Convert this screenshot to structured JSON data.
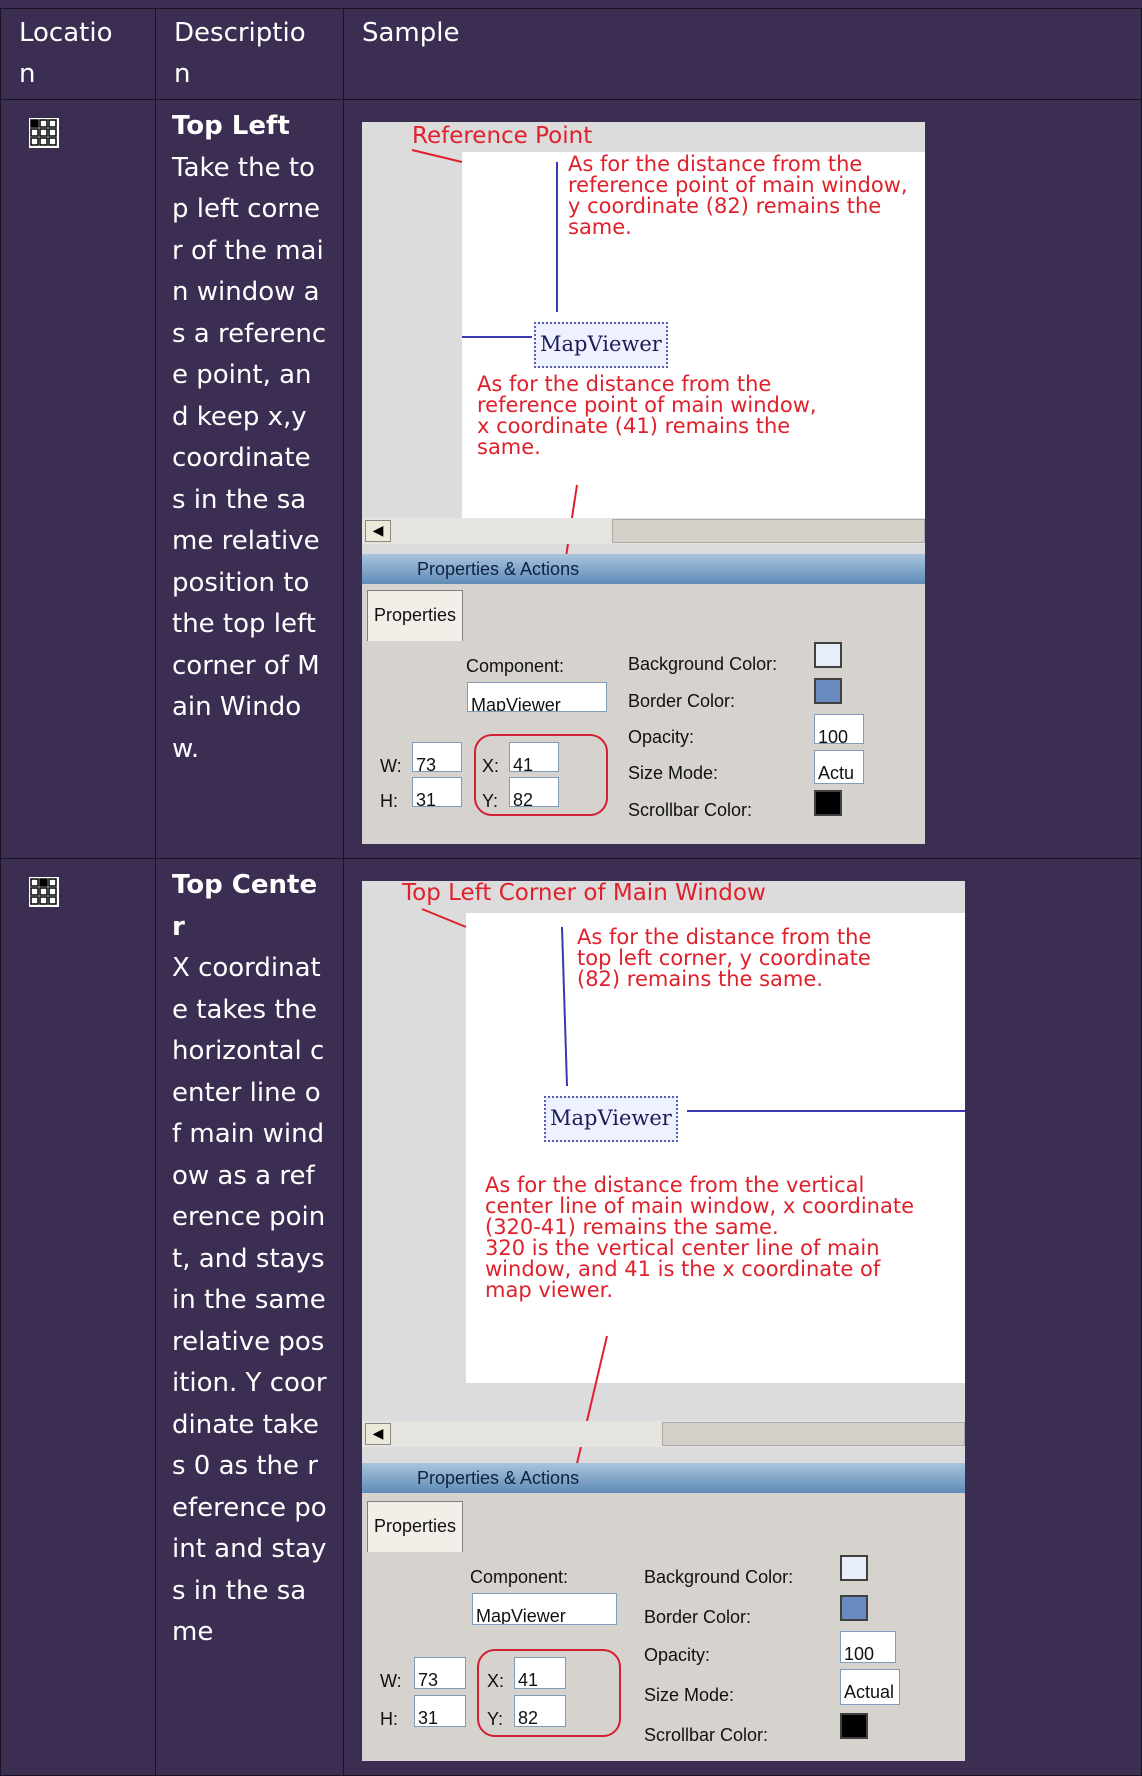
{
  "headers": {
    "location": "Locatio\nn",
    "description": "Descriptio\nn",
    "sample": "Sample"
  },
  "rows": [
    {
      "title": "Top Left",
      "icon": "grid-icon-top-left",
      "icon_active_cell": 0,
      "description": "Take the top left corner of the main window as a reference point, and keep x,y coordinate s in the same relative position to the top left corner of Main Window.",
      "sample": {
        "caption": "Reference Point",
        "note_y": "As for the distance from the\nreference point of main window,\ny coordinate (82) remains the\nsame.",
        "note_x": "As for the distance from the\nreference point of main window,\nx coordinate (41) remains the\nsame.",
        "component_name": "MapViewer",
        "panel_title": "Properties & Actions",
        "tab": "Properties",
        "labels": {
          "component": "Component:",
          "bg": "Background Color:",
          "border": "Border Color:",
          "opacity": "Opacity:",
          "size": "Size Mode:",
          "scrollbar": "Scrollbar Color:",
          "w": "W:",
          "h": "H:",
          "x": "X:",
          "y": "Y:"
        },
        "values": {
          "component": "MapViewer",
          "opacity": "100",
          "size": "Actua",
          "w": "73",
          "h": "31",
          "x": "41",
          "y": "82"
        }
      }
    },
    {
      "title": "Top Center",
      "icon": "grid-icon-top-center",
      "icon_active_cell": 1,
      "description": "X coordinate takes the horizontal center line of main window as a reference point, and stays in the same relative position. Y coordinate takes 0 as the reference point and stays in the same",
      "sample": {
        "caption": "Top Left Corner of Main Window",
        "note_y": "As for the distance from the\ntop left corner, y coordinate\n(82) remains the same.",
        "note_x": "As for the distance from the vertical\ncenter line of main window, x coordinate\n(320-41) remains the same.\n320 is the vertical center line of main\nwindow, and 41 is the x coordinate of\nmap viewer.",
        "component_name": "MapViewer",
        "panel_title": "Properties & Actions",
        "tab": "Properties",
        "labels": {
          "component": "Component:",
          "bg": "Background Color:",
          "border": "Border Color:",
          "opacity": "Opacity:",
          "size": "Size Mode:",
          "scrollbar": "Scrollbar Color:",
          "w": "W:",
          "h": "H:",
          "x": "X:",
          "y": "Y:"
        },
        "values": {
          "component": "MapViewer",
          "opacity": "100",
          "size": "Actual",
          "w": "73",
          "h": "31",
          "x": "41",
          "y": "82"
        }
      }
    }
  ]
}
